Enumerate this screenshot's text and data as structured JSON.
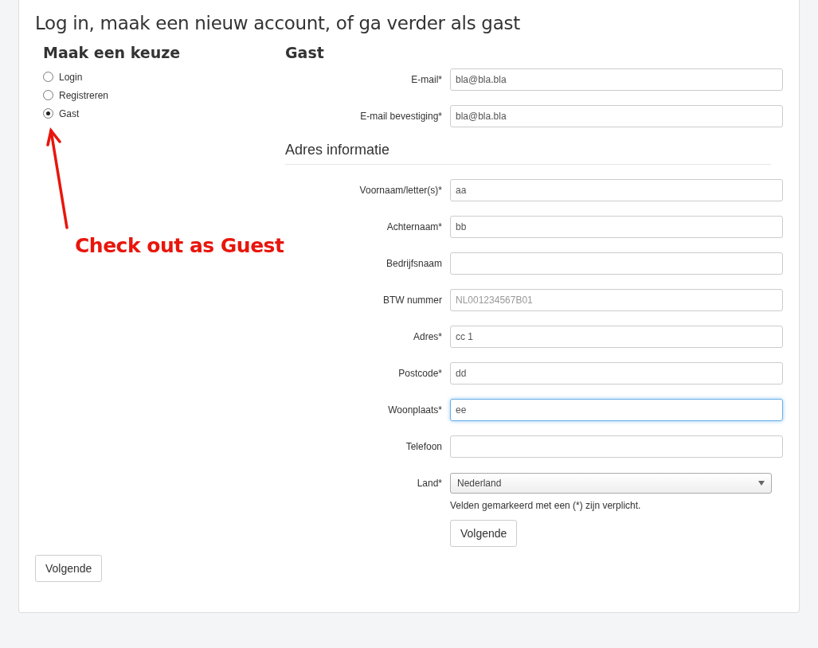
{
  "page_title": "Log in, maak een nieuw account, of ga verder als gast",
  "choice": {
    "heading": "Maak een keuze",
    "options": [
      {
        "label": "Login",
        "selected": false
      },
      {
        "label": "Registreren",
        "selected": false
      },
      {
        "label": "Gast",
        "selected": true
      }
    ]
  },
  "annotation": {
    "text": "Check out as Guest"
  },
  "guest": {
    "heading": "Gast",
    "fields": [
      {
        "kind": "input",
        "label": "E-mail*",
        "value": "bla@bla.bla",
        "focused": false
      },
      {
        "kind": "input",
        "label": "E-mail bevestiging*",
        "value": "bla@bla.bla",
        "focused": false
      }
    ]
  },
  "address": {
    "heading": "Adres informatie",
    "fields": [
      {
        "kind": "input",
        "label": "Voornaam/letter(s)*",
        "value": "aa",
        "focused": false
      },
      {
        "kind": "input",
        "label": "Achternaam*",
        "value": "bb",
        "focused": false
      },
      {
        "kind": "input",
        "label": "Bedrijfsnaam",
        "focused": false
      },
      {
        "kind": "input",
        "label": "BTW nummer",
        "placeholder": "NL001234567B01",
        "focused": false
      },
      {
        "kind": "input",
        "label": "Adres*",
        "value": "cc 1",
        "focused": false
      },
      {
        "kind": "input",
        "label": "Postcode*",
        "value": "dd",
        "focused": false
      },
      {
        "kind": "input",
        "label": "Woonplaats*",
        "value": "ee",
        "focused": true
      },
      {
        "kind": "input",
        "label": "Telefoon",
        "focused": false
      },
      {
        "kind": "select",
        "label": "Land*",
        "value": "Nederland"
      }
    ],
    "note": "Velden gemarkeerd met een (*) zijn verplicht.",
    "button": "Volgende"
  },
  "footer_button": "Volgende"
}
